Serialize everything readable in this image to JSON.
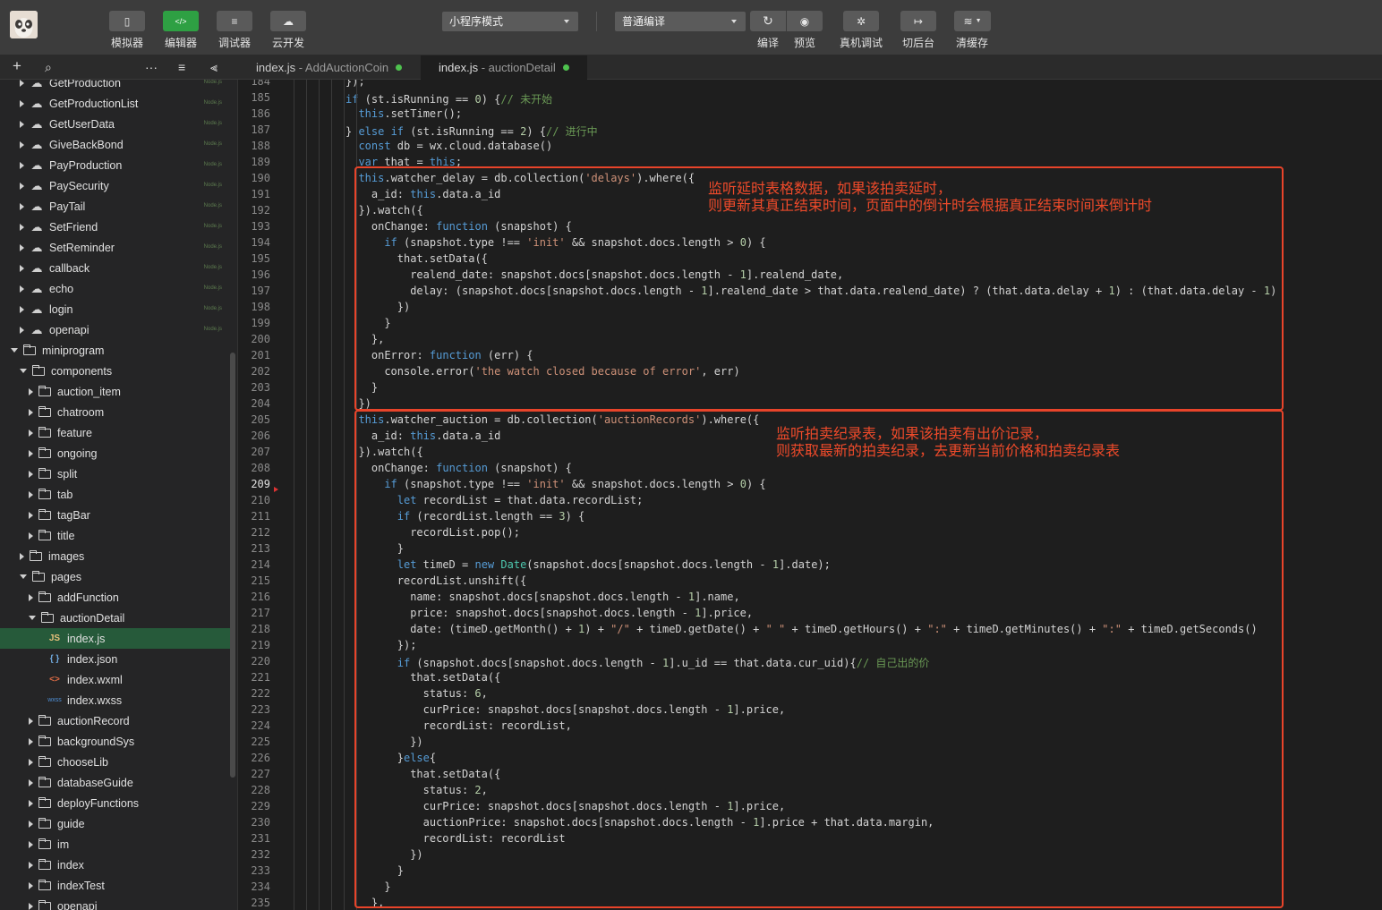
{
  "toolbar": {
    "buttons": [
      {
        "label": "模拟器",
        "icon": "phone-icon",
        "glyph": "▯"
      },
      {
        "label": "编辑器",
        "icon": "code-icon",
        "glyph": "</>"
      },
      {
        "label": "调试器",
        "icon": "debug-sliders-icon",
        "glyph": "≡"
      },
      {
        "label": "云开发",
        "icon": "cloud-icon",
        "glyph": "☁"
      }
    ],
    "mode_select": "小程序模式",
    "compile_select": "普通编译",
    "actions": [
      {
        "label": "编译",
        "icon": "refresh-icon",
        "glyph": "↻"
      },
      {
        "label": "预览",
        "icon": "eye-icon",
        "glyph": "◉"
      },
      {
        "label": "真机调试",
        "icon": "bug-icon",
        "glyph": "✲"
      },
      {
        "label": "切后台",
        "icon": "switch-background-icon",
        "glyph": "↦"
      },
      {
        "label": "清缓存",
        "icon": "layers-icon",
        "glyph": "≋"
      }
    ]
  },
  "sidebar_toolbar": {
    "add": "+",
    "search": "⌕",
    "more": "···",
    "outline": "≡",
    "collapse": "⫷"
  },
  "tree": [
    {
      "label": "GetProduction",
      "type": "cloud",
      "depth": 1,
      "arrow": "r",
      "badge": "Node.js"
    },
    {
      "label": "GetProductionList",
      "type": "cloud",
      "depth": 1,
      "arrow": "r",
      "badge": "Node.js"
    },
    {
      "label": "GetUserData",
      "type": "cloud",
      "depth": 1,
      "arrow": "r",
      "badge": "Node.js"
    },
    {
      "label": "GiveBackBond",
      "type": "cloud",
      "depth": 1,
      "arrow": "r",
      "badge": "Node.js"
    },
    {
      "label": "PayProduction",
      "type": "cloud",
      "depth": 1,
      "arrow": "r",
      "badge": "Node.js"
    },
    {
      "label": "PaySecurity",
      "type": "cloud",
      "depth": 1,
      "arrow": "r",
      "badge": "Node.js"
    },
    {
      "label": "PayTail",
      "type": "cloud",
      "depth": 1,
      "arrow": "r",
      "badge": "Node.js"
    },
    {
      "label": "SetFriend",
      "type": "cloud",
      "depth": 1,
      "arrow": "r",
      "badge": "Node.js"
    },
    {
      "label": "SetReminder",
      "type": "cloud",
      "depth": 1,
      "arrow": "r",
      "badge": "Node.js"
    },
    {
      "label": "callback",
      "type": "cloud",
      "depth": 1,
      "arrow": "r",
      "badge": "Node.js"
    },
    {
      "label": "echo",
      "type": "cloud",
      "depth": 1,
      "arrow": "r",
      "badge": "Node.js"
    },
    {
      "label": "login",
      "type": "cloud",
      "depth": 1,
      "arrow": "r",
      "badge": "Node.js"
    },
    {
      "label": "openapi",
      "type": "cloud",
      "depth": 1,
      "arrow": "r",
      "badge": "Node.js"
    },
    {
      "label": "miniprogram",
      "type": "folder",
      "depth": 0,
      "arrow": "d",
      "badge": ""
    },
    {
      "label": "components",
      "type": "folder",
      "depth": 1,
      "arrow": "d",
      "badge": ""
    },
    {
      "label": "auction_item",
      "type": "folder",
      "depth": 2,
      "arrow": "r",
      "badge": ""
    },
    {
      "label": "chatroom",
      "type": "folder",
      "depth": 2,
      "arrow": "r",
      "badge": ""
    },
    {
      "label": "feature",
      "type": "folder",
      "depth": 2,
      "arrow": "r",
      "badge": ""
    },
    {
      "label": "ongoing",
      "type": "folder",
      "depth": 2,
      "arrow": "r",
      "badge": ""
    },
    {
      "label": "split",
      "type": "folder",
      "depth": 2,
      "arrow": "r",
      "badge": ""
    },
    {
      "label": "tab",
      "type": "folder",
      "depth": 2,
      "arrow": "r",
      "badge": ""
    },
    {
      "label": "tagBar",
      "type": "folder",
      "depth": 2,
      "arrow": "r",
      "badge": ""
    },
    {
      "label": "title",
      "type": "folder",
      "depth": 2,
      "arrow": "r",
      "badge": ""
    },
    {
      "label": "images",
      "type": "folder",
      "depth": 1,
      "arrow": "r",
      "badge": ""
    },
    {
      "label": "pages",
      "type": "folder",
      "depth": 1,
      "arrow": "d",
      "badge": ""
    },
    {
      "label": "addFunction",
      "type": "folder",
      "depth": 2,
      "arrow": "r",
      "badge": ""
    },
    {
      "label": "auctionDetail",
      "type": "folder",
      "depth": 2,
      "arrow": "d",
      "badge": ""
    },
    {
      "label": "index.js",
      "type": "js",
      "depth": 3,
      "arrow": "",
      "badge": "",
      "selected": true
    },
    {
      "label": "index.json",
      "type": "json",
      "depth": 3,
      "arrow": "",
      "badge": ""
    },
    {
      "label": "index.wxml",
      "type": "wxml",
      "depth": 3,
      "arrow": "",
      "badge": ""
    },
    {
      "label": "index.wxss",
      "type": "wxss",
      "depth": 3,
      "arrow": "",
      "badge": ""
    },
    {
      "label": "auctionRecord",
      "type": "folder",
      "depth": 2,
      "arrow": "r",
      "badge": ""
    },
    {
      "label": "backgroundSys",
      "type": "folder",
      "depth": 2,
      "arrow": "r",
      "badge": ""
    },
    {
      "label": "chooseLib",
      "type": "folder",
      "depth": 2,
      "arrow": "r",
      "badge": ""
    },
    {
      "label": "databaseGuide",
      "type": "folder",
      "depth": 2,
      "arrow": "r",
      "badge": ""
    },
    {
      "label": "deployFunctions",
      "type": "folder",
      "depth": 2,
      "arrow": "r",
      "badge": ""
    },
    {
      "label": "guide",
      "type": "folder",
      "depth": 2,
      "arrow": "r",
      "badge": ""
    },
    {
      "label": "im",
      "type": "folder",
      "depth": 2,
      "arrow": "r",
      "badge": ""
    },
    {
      "label": "index",
      "type": "folder",
      "depth": 2,
      "arrow": "r",
      "badge": ""
    },
    {
      "label": "indexTest",
      "type": "folder",
      "depth": 2,
      "arrow": "r",
      "badge": ""
    },
    {
      "label": "openapi",
      "type": "folder",
      "depth": 2,
      "arrow": "r",
      "badge": ""
    }
  ],
  "tabs": [
    {
      "name": "index.js",
      "sub": " - AddAuctionCoin",
      "active": false
    },
    {
      "name": "index.js",
      "sub": " - auctionDetail",
      "active": true
    }
  ],
  "icon_glyphs": {
    "cloud": "☁",
    "js": "JS",
    "json": "{ }",
    "wxml": "<>",
    "wxss": "wxss"
  },
  "current_line": 209,
  "code_lines": [
    {
      "n": "184",
      "i": 4,
      "t": [
        [
          "p",
          "});"
        ]
      ]
    },
    {
      "n": "185",
      "i": 4,
      "t": [
        [
          "k",
          "if"
        ],
        [
          "p",
          " (st.isRunning == "
        ],
        [
          "n",
          "0"
        ],
        [
          "p",
          ") {"
        ],
        [
          "c",
          "// 未开始"
        ]
      ]
    },
    {
      "n": "186",
      "i": 5,
      "t": [
        [
          "k",
          "this"
        ],
        [
          "p",
          ".setTimer();"
        ]
      ]
    },
    {
      "n": "187",
      "i": 4,
      "t": [
        [
          "p",
          "} "
        ],
        [
          "k",
          "else if"
        ],
        [
          "p",
          " (st.isRunning == "
        ],
        [
          "n",
          "2"
        ],
        [
          "p",
          ") {"
        ],
        [
          "c",
          "// 进行中"
        ]
      ]
    },
    {
      "n": "188",
      "i": 5,
      "t": [
        [
          "k",
          "const"
        ],
        [
          "p",
          " db = wx.cloud.database()"
        ]
      ]
    },
    {
      "n": "189",
      "i": 5,
      "t": [
        [
          "k",
          "var"
        ],
        [
          "p",
          " that = "
        ],
        [
          "k",
          "this"
        ],
        [
          "p",
          ";"
        ]
      ]
    },
    {
      "n": "190",
      "i": 5,
      "t": [
        [
          "k",
          "this"
        ],
        [
          "p",
          ".watcher_delay = db.collection("
        ],
        [
          "s",
          "'delays'"
        ],
        [
          "p",
          ").where({"
        ]
      ]
    },
    {
      "n": "191",
      "i": 6,
      "t": [
        [
          "p",
          "a_id: "
        ],
        [
          "k",
          "this"
        ],
        [
          "p",
          ".data.a_id"
        ]
      ]
    },
    {
      "n": "192",
      "i": 5,
      "t": [
        [
          "p",
          "}).watch({"
        ]
      ]
    },
    {
      "n": "193",
      "i": 6,
      "t": [
        [
          "p",
          "onChange: "
        ],
        [
          "k",
          "function"
        ],
        [
          "p",
          " (snapshot) {"
        ]
      ]
    },
    {
      "n": "194",
      "i": 7,
      "t": [
        [
          "k",
          "if"
        ],
        [
          "p",
          " (snapshot.type !== "
        ],
        [
          "s",
          "'init'"
        ],
        [
          "p",
          " && snapshot.docs.length > "
        ],
        [
          "n",
          "0"
        ],
        [
          "p",
          ") {"
        ]
      ]
    },
    {
      "n": "195",
      "i": 8,
      "t": [
        [
          "p",
          "that.setData({"
        ]
      ]
    },
    {
      "n": "196",
      "i": 9,
      "t": [
        [
          "p",
          "realend_date: snapshot.docs[snapshot.docs.length - "
        ],
        [
          "n",
          "1"
        ],
        [
          "p",
          "].realend_date,"
        ]
      ]
    },
    {
      "n": "197",
      "i": 9,
      "t": [
        [
          "p",
          "delay: (snapshot.docs[snapshot.docs.length - "
        ],
        [
          "n",
          "1"
        ],
        [
          "p",
          "].realend_date > that.data.realend_date) ? (that.data.delay + "
        ],
        [
          "n",
          "1"
        ],
        [
          "p",
          ") : (that.data.delay - "
        ],
        [
          "n",
          "1"
        ],
        [
          "p",
          ")"
        ]
      ]
    },
    {
      "n": "198",
      "i": 8,
      "t": [
        [
          "p",
          "})"
        ]
      ]
    },
    {
      "n": "199",
      "i": 7,
      "t": [
        [
          "p",
          "}"
        ]
      ]
    },
    {
      "n": "200",
      "i": 6,
      "t": [
        [
          "p",
          "},"
        ]
      ]
    },
    {
      "n": "201",
      "i": 6,
      "t": [
        [
          "p",
          "onError: "
        ],
        [
          "k",
          "function"
        ],
        [
          "p",
          " (err) {"
        ]
      ]
    },
    {
      "n": "202",
      "i": 7,
      "t": [
        [
          "p",
          "console.error("
        ],
        [
          "s",
          "'the watch closed because of error'"
        ],
        [
          "p",
          ", err)"
        ]
      ]
    },
    {
      "n": "203",
      "i": 6,
      "t": [
        [
          "p",
          "}"
        ]
      ]
    },
    {
      "n": "204",
      "i": 5,
      "t": [
        [
          "p",
          "})"
        ]
      ]
    },
    {
      "n": "205",
      "i": 5,
      "t": [
        [
          "k",
          "this"
        ],
        [
          "p",
          ".watcher_auction = db.collection("
        ],
        [
          "s",
          "'auctionRecords'"
        ],
        [
          "p",
          ").where({"
        ]
      ]
    },
    {
      "n": "206",
      "i": 6,
      "t": [
        [
          "p",
          "a_id: "
        ],
        [
          "k",
          "this"
        ],
        [
          "p",
          ".data.a_id"
        ]
      ]
    },
    {
      "n": "207",
      "i": 5,
      "t": [
        [
          "p",
          "}).watch({"
        ]
      ]
    },
    {
      "n": "208",
      "i": 6,
      "t": [
        [
          "p",
          "onChange: "
        ],
        [
          "k",
          "function"
        ],
        [
          "p",
          " (snapshot) {"
        ]
      ]
    },
    {
      "n": "209",
      "i": 7,
      "t": [
        [
          "k",
          "if"
        ],
        [
          "p",
          " (snapshot.type !== "
        ],
        [
          "s",
          "'init'"
        ],
        [
          "p",
          " && snapshot.docs.length > "
        ],
        [
          "n",
          "0"
        ],
        [
          "p",
          ") {"
        ]
      ]
    },
    {
      "n": "210",
      "i": 8,
      "t": [
        [
          "k",
          "let"
        ],
        [
          "p",
          " recordList = that.data.recordList;"
        ]
      ]
    },
    {
      "n": "211",
      "i": 8,
      "t": [
        [
          "k",
          "if"
        ],
        [
          "p",
          " (recordList.length == "
        ],
        [
          "n",
          "3"
        ],
        [
          "p",
          ") {"
        ]
      ]
    },
    {
      "n": "212",
      "i": 9,
      "t": [
        [
          "p",
          "recordList.pop();"
        ]
      ]
    },
    {
      "n": "213",
      "i": 8,
      "t": [
        [
          "p",
          "}"
        ]
      ]
    },
    {
      "n": "214",
      "i": 8,
      "t": [
        [
          "k",
          "let"
        ],
        [
          "p",
          " timeD = "
        ],
        [
          "k",
          "new"
        ],
        [
          "p",
          " "
        ],
        [
          "t",
          "Date"
        ],
        [
          "p",
          "(snapshot.docs[snapshot.docs.length - "
        ],
        [
          "n",
          "1"
        ],
        [
          "p",
          "].date);"
        ]
      ]
    },
    {
      "n": "215",
      "i": 8,
      "t": [
        [
          "p",
          "recordList.unshift({"
        ]
      ]
    },
    {
      "n": "216",
      "i": 9,
      "t": [
        [
          "p",
          "name: snapshot.docs[snapshot.docs.length - "
        ],
        [
          "n",
          "1"
        ],
        [
          "p",
          "].name,"
        ]
      ]
    },
    {
      "n": "217",
      "i": 9,
      "t": [
        [
          "p",
          "price: snapshot.docs[snapshot.docs.length - "
        ],
        [
          "n",
          "1"
        ],
        [
          "p",
          "].price,"
        ]
      ]
    },
    {
      "n": "218",
      "i": 9,
      "t": [
        [
          "p",
          "date: (timeD.getMonth() + "
        ],
        [
          "n",
          "1"
        ],
        [
          "p",
          ") + "
        ],
        [
          "s",
          "\"/\""
        ],
        [
          "p",
          " + timeD.getDate() + "
        ],
        [
          "s",
          "\" \""
        ],
        [
          "p",
          " + timeD.getHours() + "
        ],
        [
          "s",
          "\":\""
        ],
        [
          "p",
          " + timeD.getMinutes() + "
        ],
        [
          "s",
          "\":\""
        ],
        [
          "p",
          " + timeD.getSeconds()"
        ]
      ]
    },
    {
      "n": "219",
      "i": 8,
      "t": [
        [
          "p",
          "});"
        ]
      ]
    },
    {
      "n": "220",
      "i": 8,
      "t": [
        [
          "k",
          "if"
        ],
        [
          "p",
          " (snapshot.docs[snapshot.docs.length - "
        ],
        [
          "n",
          "1"
        ],
        [
          "p",
          "].u_id == that.data.cur_uid){"
        ],
        [
          "c",
          "// 自己出的价"
        ]
      ]
    },
    {
      "n": "221",
      "i": 9,
      "t": [
        [
          "p",
          "that.setData({"
        ]
      ]
    },
    {
      "n": "222",
      "i": 10,
      "t": [
        [
          "p",
          "status: "
        ],
        [
          "n",
          "6"
        ],
        [
          "p",
          ","
        ]
      ]
    },
    {
      "n": "223",
      "i": 10,
      "t": [
        [
          "p",
          "curPrice: snapshot.docs[snapshot.docs.length - "
        ],
        [
          "n",
          "1"
        ],
        [
          "p",
          "].price,"
        ]
      ]
    },
    {
      "n": "224",
      "i": 10,
      "t": [
        [
          "p",
          "recordList: recordList,"
        ]
      ]
    },
    {
      "n": "225",
      "i": 9,
      "t": [
        [
          "p",
          "})"
        ]
      ]
    },
    {
      "n": "226",
      "i": 8,
      "t": [
        [
          "p",
          "}"
        ],
        [
          "k",
          "else"
        ],
        [
          "p",
          "{"
        ]
      ]
    },
    {
      "n": "227",
      "i": 9,
      "t": [
        [
          "p",
          "that.setData({"
        ]
      ]
    },
    {
      "n": "228",
      "i": 10,
      "t": [
        [
          "p",
          "status: "
        ],
        [
          "n",
          "2"
        ],
        [
          "p",
          ","
        ]
      ]
    },
    {
      "n": "229",
      "i": 10,
      "t": [
        [
          "p",
          "curPrice: snapshot.docs[snapshot.docs.length - "
        ],
        [
          "n",
          "1"
        ],
        [
          "p",
          "].price,"
        ]
      ]
    },
    {
      "n": "230",
      "i": 10,
      "t": [
        [
          "p",
          "auctionPrice: snapshot.docs[snapshot.docs.length - "
        ],
        [
          "n",
          "1"
        ],
        [
          "p",
          "].price + that.data.margin,"
        ]
      ]
    },
    {
      "n": "231",
      "i": 10,
      "t": [
        [
          "p",
          "recordList: recordList"
        ]
      ]
    },
    {
      "n": "232",
      "i": 9,
      "t": [
        [
          "p",
          "})"
        ]
      ]
    },
    {
      "n": "233",
      "i": 8,
      "t": [
        [
          "p",
          "}"
        ]
      ]
    },
    {
      "n": "234",
      "i": 7,
      "t": [
        [
          "p",
          "}"
        ]
      ]
    },
    {
      "n": "235",
      "i": 6,
      "t": [
        [
          "p",
          "},"
        ]
      ]
    }
  ],
  "annotations": [
    {
      "lines": [
        "监听延时表格数据，如果该拍卖延时，",
        "则更新其真正结束时间，页面中的倒计时会根据真正结束时间来倒计时"
      ]
    },
    {
      "lines": [
        "监听拍卖纪录表，如果该拍卖有出价记录，",
        "则获取最新的拍卖纪录，去更新当前价格和拍卖纪录表"
      ]
    }
  ],
  "colors": {
    "accent_green": "#2ea043",
    "annotation_red": "#e8442a",
    "selected_row": "#265a3a"
  }
}
